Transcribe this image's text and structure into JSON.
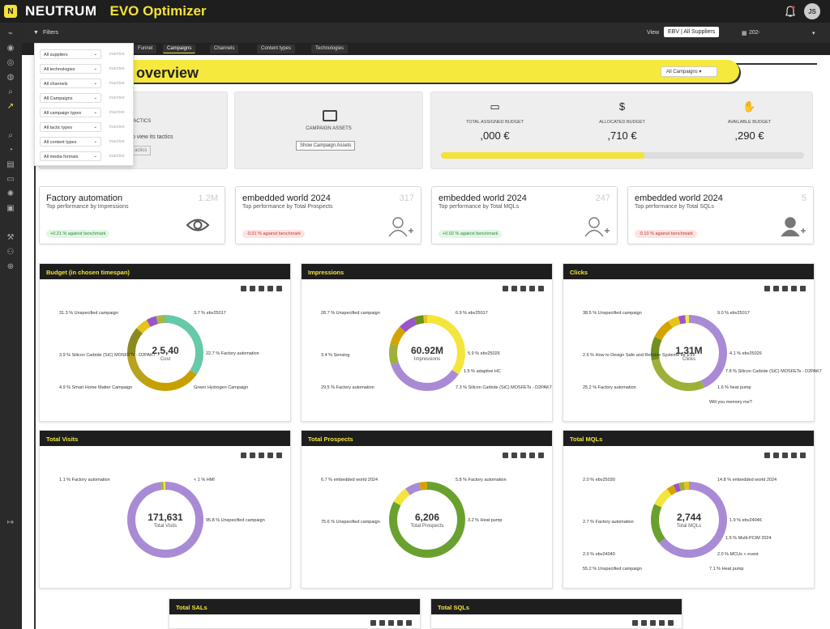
{
  "header": {
    "brand": "NEUTRUM",
    "app": "EVO Optimizer",
    "avatar_initials": "JS",
    "logo_letter": "N"
  },
  "filterbar": {
    "filters_label": "Filters",
    "view_label": "View",
    "view_value": "EBV | All Suppliers",
    "date_value": "202-"
  },
  "tabs": [
    "Funnel",
    "Campaigns",
    "Channels",
    "Content types",
    "Technologies"
  ],
  "filter_dropdown": [
    {
      "label": "All suppliers",
      "state": "inactive"
    },
    {
      "label": "All technologies",
      "state": "inactive"
    },
    {
      "label": "All channels",
      "state": "inactive"
    },
    {
      "label": "All Campaigns",
      "state": "inactive"
    },
    {
      "label": "All campaign types",
      "state": "inactive"
    },
    {
      "label": "All tactic types",
      "state": "inactive"
    },
    {
      "label": "All content types",
      "state": "inactive"
    },
    {
      "label": "All media formats",
      "state": "inactive"
    }
  ],
  "overview": {
    "title": "overview",
    "campaign_select": "All Campaigns"
  },
  "tactics_card": {
    "title": "TACTICS",
    "text": "to view its tactics",
    "button": "actics"
  },
  "assets_card": {
    "title": "CAMPAIGN ASSETS",
    "button": "Show Campaign Assets"
  },
  "budget": {
    "total_label": "TOTAL ASSIGNED BUDGET",
    "total_value": ",000 €",
    "allocated_label": "ALLOCATED BUDGET",
    "allocated_value": ",710 €",
    "available_label": "AVAILABLE BUDGET",
    "available_value": ",290 €",
    "progress": 0.56,
    "progress_color": "#f4e23a"
  },
  "kpis": [
    {
      "title": "Factory automation",
      "sub": "Top performance by Impressions",
      "value": "1.2M",
      "badge": "+0.21 % against benchmark",
      "trend": "good",
      "icon": "eye-icon"
    },
    {
      "title": "embedded world 2024",
      "sub": "Top performance by Total Prospects",
      "value": "317",
      "badge": "-0.01 % against benchmark",
      "trend": "bad",
      "icon": "user-plus-icon"
    },
    {
      "title": "embedded world 2024",
      "sub": "Top performance by Total MQLs",
      "value": "247",
      "badge": "+0.02 % against benchmark",
      "trend": "good",
      "icon": "user-plus-icon"
    },
    {
      "title": "embedded world 2024",
      "sub": "Top performance by Total SQLs",
      "value": "5",
      "badge": "-0.10 % against benchmark",
      "trend": "bad",
      "icon": "user-add-icon"
    }
  ],
  "panels": [
    {
      "title": "Budget (in chosen timespan)",
      "center_value": "2,5,40",
      "center_sub": "Cost",
      "colors": [
        "#66c9a7",
        "#c7a000",
        "#b8a21e",
        "#8a8a1f",
        "#e6c41b",
        "#9a55c9",
        "#a3b84a"
      ],
      "segments": [
        31.3,
        22.7,
        13,
        11,
        4.9,
        3.9,
        3.7
      ],
      "labels": [
        {
          "t": "31.3 % Unspecified campaign"
        },
        {
          "t": "3.7 % ebv25017"
        },
        {
          "t": "22.7 % Factory automation"
        },
        {
          "t": "3.9 % Silicon Carbide (SiC) MOSFETs - D2PAK7"
        },
        {
          "t": "4.9 % Smart Home Matter Campaign"
        },
        {
          "t": "Green Hydrogen Campaign"
        }
      ]
    },
    {
      "title": "Impressions",
      "center_value": "60.92M",
      "center_sub": "Impressions",
      "colors": [
        "#f4e53c",
        "#a88bd4",
        "#9fb038",
        "#d4a300",
        "#9a55c9",
        "#6f8f1f",
        "#e6c41b"
      ],
      "segments": [
        28.7,
        29.5,
        7.3,
        6.9,
        5.9,
        3.4,
        1.5
      ],
      "labels": [
        {
          "t": "28.7 % Unspecified campaign"
        },
        {
          "t": "6.9 % ebv25017"
        },
        {
          "t": "5.9 % ebv25026"
        },
        {
          "t": "3.4 % Sensing"
        },
        {
          "t": "29.5 % Factory automation"
        },
        {
          "t": "7.3 % Silicon Carbide (SiC) MOSFETs - D2PAK7"
        },
        {
          "t": "1.5 % adaptive HC"
        }
      ]
    },
    {
      "title": "Clicks",
      "center_value": "1.31M",
      "center_sub": "Clicks",
      "colors": [
        "#a88bd4",
        "#9fb038",
        "#6f8f1f",
        "#d4a300",
        "#e6c41b",
        "#9a55c9",
        "#f4e53c"
      ],
      "segments": [
        38.5,
        25.2,
        9.0,
        7.8,
        4.1,
        2.6,
        1.6
      ],
      "labels": [
        {
          "t": "38.5 % Unspecified campaign"
        },
        {
          "t": "9.0 % ebv25017"
        },
        {
          "t": "4.1 % ebv25026"
        },
        {
          "t": "2.6 % How to Design Safe and Reliable Systems for EVs"
        },
        {
          "t": "25.2 % Factory automation"
        },
        {
          "t": "1.6 % heat pump"
        },
        {
          "t": "7.8 % Silicon Carbide (SiC) MOSFETs - D2PAK7"
        },
        {
          "t": "Will you memory me?"
        }
      ]
    },
    {
      "title": "Total Visits",
      "center_value": "171,631",
      "center_sub": "Total Visits",
      "colors": [
        "#a88bd4",
        "#9fb038",
        "#f4e53c"
      ],
      "segments": [
        95.8,
        1.1,
        1.0
      ],
      "labels": [
        {
          "t": "1.1 % Factory automation"
        },
        {
          "t": "< 1 % HMI"
        },
        {
          "t": "95.8 % Unspecified campaign"
        }
      ]
    },
    {
      "title": "Total Prospects",
      "center_value": "6,206",
      "center_sub": "Total Prospects",
      "colors": [
        "#6aa12e",
        "#f4e53c",
        "#a88bd4",
        "#d4a300"
      ],
      "segments": [
        75.6,
        6.7,
        5.8,
        3.2
      ],
      "labels": [
        {
          "t": "6.7 % embedded world 2024"
        },
        {
          "t": "5.8 % Factory automation"
        },
        {
          "t": "3.2 % Heat pump"
        },
        {
          "t": "75.6 % Unspecified campaign"
        }
      ]
    },
    {
      "title": "Total MQLs",
      "center_value": "2,744",
      "center_sub": "Total MQLs",
      "colors": [
        "#a88bd4",
        "#6aa12e",
        "#f4e53c",
        "#d4a300",
        "#9a55c9",
        "#9fb038",
        "#e6c41b"
      ],
      "segments": [
        55.2,
        14.8,
        7.1,
        2.7,
        2.0,
        2.0,
        1.9
      ],
      "labels": [
        {
          "t": "2.0 % ebv25030"
        },
        {
          "t": "14.8 % embedded world 2024"
        },
        {
          "t": "1.9 % ebv24046"
        },
        {
          "t": "2.7 % Factory automation"
        },
        {
          "t": "2.0 % ebv24040"
        },
        {
          "t": "2.0 % MCUs + event"
        },
        {
          "t": "1.5 % Multi-PCIM 2024"
        },
        {
          "t": "7.1 % Heat pump"
        },
        {
          "t": "55.2 % Unspecified campaign"
        }
      ]
    }
  ],
  "bottom_panels": [
    "Total SALs",
    "Total SQLs"
  ]
}
